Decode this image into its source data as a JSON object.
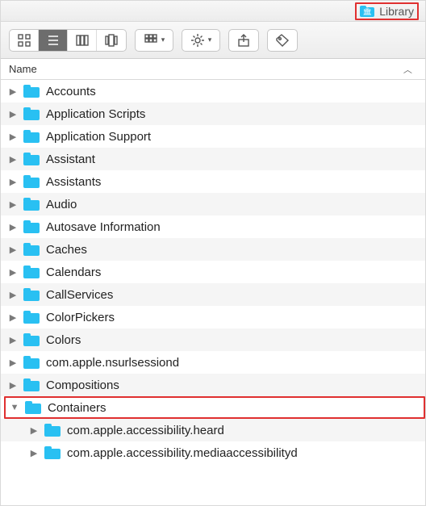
{
  "title": {
    "label": "Library"
  },
  "toolbar": {
    "views": [
      "icon-view",
      "list-view",
      "column-view",
      "coverflow-view"
    ],
    "active_view": 1
  },
  "column_header": {
    "name": "Name",
    "sort": "asc"
  },
  "items": [
    {
      "label": "Accounts",
      "expanded": false
    },
    {
      "label": "Application Scripts",
      "expanded": false
    },
    {
      "label": "Application Support",
      "expanded": false
    },
    {
      "label": "Assistant",
      "expanded": false
    },
    {
      "label": "Assistants",
      "expanded": false
    },
    {
      "label": "Audio",
      "expanded": false
    },
    {
      "label": "Autosave Information",
      "expanded": false
    },
    {
      "label": "Caches",
      "expanded": false
    },
    {
      "label": "Calendars",
      "expanded": false
    },
    {
      "label": "CallServices",
      "expanded": false
    },
    {
      "label": "ColorPickers",
      "expanded": false
    },
    {
      "label": "Colors",
      "expanded": false
    },
    {
      "label": "com.apple.nsurlsessiond",
      "expanded": false
    },
    {
      "label": "Compositions",
      "expanded": false
    },
    {
      "label": "Containers",
      "expanded": true,
      "highlight": true,
      "children": [
        {
          "label": "com.apple.accessibility.heard",
          "expanded": false
        },
        {
          "label": "com.apple.accessibility.mediaaccessibilityd",
          "expanded": false
        }
      ]
    }
  ]
}
